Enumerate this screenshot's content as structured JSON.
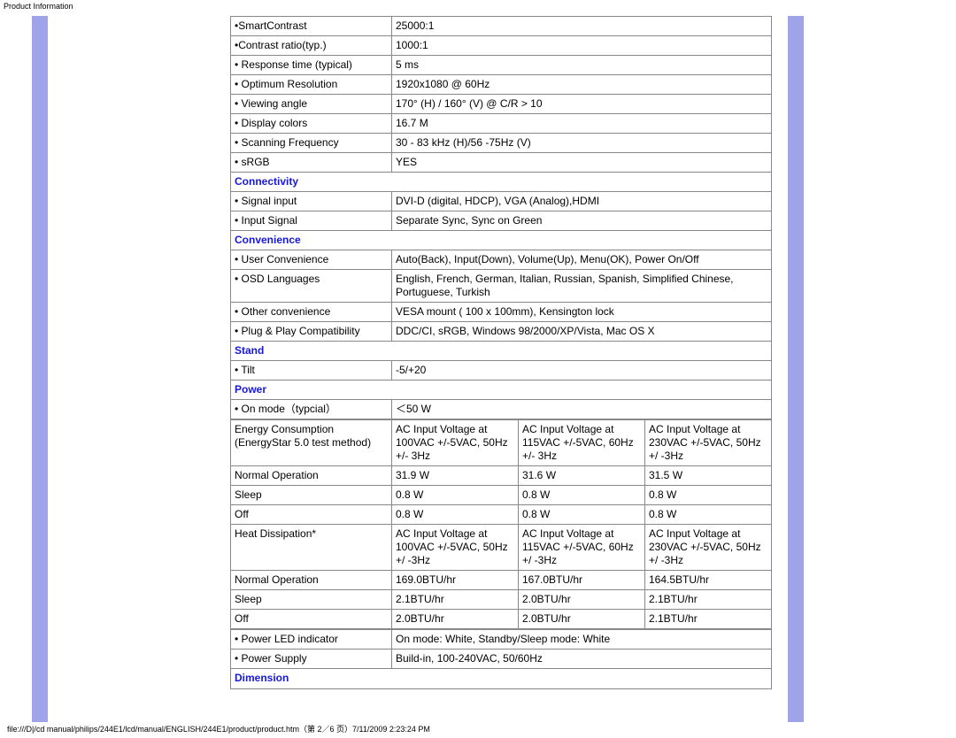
{
  "header": "Product Information",
  "footer": "file:///D|/cd manual/philips/244E1/lcd/manual/ENGLISH/244E1/product/product.htm（第 2／6 页）7/11/2009 2:23:24 PM",
  "display": {
    "rows": [
      {
        "label": " •SmartContrast",
        "value": "25000:1"
      },
      {
        "label": " •Contrast ratio(typ.)",
        "value": "1000:1"
      },
      {
        "label": " • Response time (typical)",
        "value": "5 ms"
      },
      {
        "label": " • Optimum Resolution",
        "value": "1920x1080 @ 60Hz"
      },
      {
        "label": " • Viewing angle",
        "value": "170° (H) / 160° (V) @ C/R > 10"
      },
      {
        "label": " • Display colors",
        "value": "16.7 M"
      },
      {
        "label": " • Scanning Frequency",
        "value": "30 - 83 kHz (H)/56 -75Hz (V)"
      },
      {
        "label": " • sRGB",
        "value": "  YES"
      }
    ]
  },
  "connectivity": {
    "title": "Connectivity",
    "rows": [
      {
        "label": " • Signal input",
        "value": "DVI-D (digital, HDCP), VGA (Analog),HDMI"
      },
      {
        "label": " • Input Signal",
        "value": "Separate Sync, Sync on Green"
      }
    ]
  },
  "convenience": {
    "title": "Convenience",
    "rows": [
      {
        "label": " • User Convenience",
        "value": "Auto(Back), Input(Down), Volume(Up), Menu(OK), Power On/Off"
      },
      {
        "label": " • OSD Languages",
        "value": "English, French, German, Italian, Russian, Spanish, Simplified Chinese, Portuguese, Turkish"
      },
      {
        "label": " • Other convenience",
        "value": "VESA mount ( 100 x 100mm), Kensington lock"
      },
      {
        "label": " • Plug & Play Compatibility",
        "value": "DDC/CI, sRGB, Windows 98/2000/XP/Vista, Mac OS X"
      }
    ]
  },
  "stand": {
    "title": "Stand",
    "rows": [
      {
        "label": " • Tilt",
        "value": "-5/+20"
      }
    ]
  },
  "power": {
    "title": "Power",
    "onmode": {
      "label": " • On mode（typcial）",
      "value": "＜50 W"
    },
    "energy": {
      "header": {
        "label": "Energy Consumption (EnergyStar 5.0 test method)",
        "c1": "AC Input Voltage at 100VAC +/-5VAC, 50Hz +/- 3Hz",
        "c2": "AC Input Voltage at 115VAC +/-5VAC, 60Hz +/- 3Hz",
        "c3": "AC Input Voltage at 230VAC +/-5VAC, 50Hz +/ -3Hz"
      },
      "rows": [
        {
          "label": "Normal Operation",
          "c1": "31.9 W",
          "c2": "31.6 W",
          "c3": "31.5 W"
        },
        {
          "label": "Sleep",
          "c1": "0.8 W",
          "c2": "0.8 W",
          "c3": "0.8 W"
        },
        {
          "label": "Off",
          "c1": "0.8 W",
          "c2": "0.8 W",
          "c3": "0.8 W"
        }
      ]
    },
    "heat": {
      "header": {
        "label": "Heat Dissipation*",
        "c1": "AC Input Voltage at 100VAC +/-5VAC, 50Hz +/ -3Hz",
        "c2": "AC Input Voltage at 115VAC +/-5VAC, 60Hz +/ -3Hz",
        "c3": "AC Input Voltage at 230VAC +/-5VAC, 50Hz +/ -3Hz"
      },
      "rows": [
        {
          "label": "Normal Operation",
          "c1": "169.0BTU/hr",
          "c2": "167.0BTU/hr",
          "c3": "164.5BTU/hr"
        },
        {
          "label": "Sleep",
          "c1": "2.1BTU/hr",
          "c2": "2.0BTU/hr",
          "c3": "2.1BTU/hr"
        },
        {
          "label": "Off",
          "c1": "2.0BTU/hr",
          "c2": "2.0BTU/hr",
          "c3": "2.1BTU/hr"
        }
      ]
    },
    "misc": [
      {
        "label": " • Power LED indicator",
        "value": "On mode: White, Standby/Sleep mode: White"
      },
      {
        "label": " • Power Supply",
        "value": "Build-in, 100-240VAC, 50/60Hz"
      }
    ]
  },
  "dimension": {
    "title": "Dimension"
  }
}
